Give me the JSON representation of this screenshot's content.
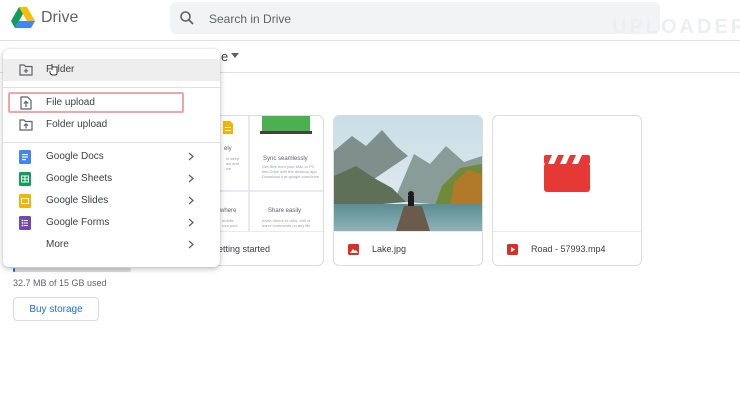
{
  "app": {
    "name": "Drive"
  },
  "search": {
    "placeholder": "Search in Drive"
  },
  "storage": {
    "used_text": "32.7 MB of 15 GB used",
    "used_fraction": 0.002,
    "buy_label": "Buy storage"
  },
  "new_menu": {
    "items": [
      {
        "label": "Folder",
        "icon": "new-folder-icon"
      },
      {
        "label": "File upload",
        "icon": "file-upload-icon"
      },
      {
        "label": "Folder upload",
        "icon": "folder-upload-icon"
      },
      {
        "label": "Google Docs",
        "icon": "docs-icon",
        "color": "#4285f4"
      },
      {
        "label": "Google Sheets",
        "icon": "sheets-icon",
        "color": "#0f9d58"
      },
      {
        "label": "Google Slides",
        "icon": "slides-icon",
        "color": "#f4b400"
      },
      {
        "label": "Google Forms",
        "icon": "forms-icon",
        "color": "#7248b9"
      },
      {
        "label": "More",
        "icon": "chevron-right-icon"
      }
    ]
  },
  "files": [
    {
      "name": "etting started",
      "thumbnail": {
        "cells": [
          {
            "title": "ely"
          },
          {
            "title": "Sync seamlessly"
          },
          {
            "title": "where"
          },
          {
            "title": "Share easily"
          }
        ]
      }
    },
    {
      "name": "Lake.jpg",
      "icon": "image-file-icon",
      "color": "#d93025"
    },
    {
      "name": "Road - 57993.mp4",
      "icon": "video-file-icon",
      "color": "#d93025"
    }
  ],
  "watermark": "UPLOADER"
}
